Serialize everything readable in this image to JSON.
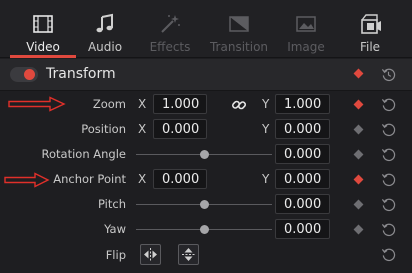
{
  "tabs": [
    {
      "label": "Video",
      "icon": "video-panel-icon",
      "state": "active"
    },
    {
      "label": "Audio",
      "icon": "music-note-icon",
      "state": "normal"
    },
    {
      "label": "Effects",
      "icon": "magic-wand-icon",
      "state": "disabled"
    },
    {
      "label": "Transition",
      "icon": "transition-icon",
      "state": "disabled"
    },
    {
      "label": "Image",
      "icon": "image-icon",
      "state": "disabled"
    },
    {
      "label": "File",
      "icon": "file-film-icon",
      "state": "normal"
    }
  ],
  "section": {
    "title": "Transform",
    "enabled": true,
    "keyframe_active": true
  },
  "rows": {
    "zoom": {
      "label": "Zoom",
      "x_axis": "X",
      "x": "1.000",
      "y_axis": "Y",
      "y": "1.000",
      "linked": true,
      "keyframe_active": true
    },
    "position": {
      "label": "Position",
      "x_axis": "X",
      "x": "0.000",
      "y_axis": "Y",
      "y": "0.000",
      "keyframe_active": false
    },
    "rotation": {
      "label": "Rotation Angle",
      "value": "0.000",
      "slider": 0.5,
      "keyframe_active": false
    },
    "anchor": {
      "label": "Anchor Point",
      "x_axis": "X",
      "x": "0.000",
      "y_axis": "Y",
      "y": "0.000",
      "keyframe_active": true
    },
    "pitch": {
      "label": "Pitch",
      "value": "0.000",
      "slider": 0.5,
      "keyframe_active": false
    },
    "yaw": {
      "label": "Yaw",
      "value": "0.000",
      "slider": 0.5,
      "keyframe_active": false
    },
    "flip": {
      "label": "Flip",
      "buttons": [
        "flip-horizontal-icon",
        "flip-vertical-icon"
      ]
    }
  },
  "annotations": {
    "arrow_color": "#e0302a",
    "targets": [
      "Zoom",
      "Anchor Point"
    ]
  },
  "colors": {
    "accent": "#e0493e",
    "background": "#1e1e21",
    "field": "#151517"
  }
}
